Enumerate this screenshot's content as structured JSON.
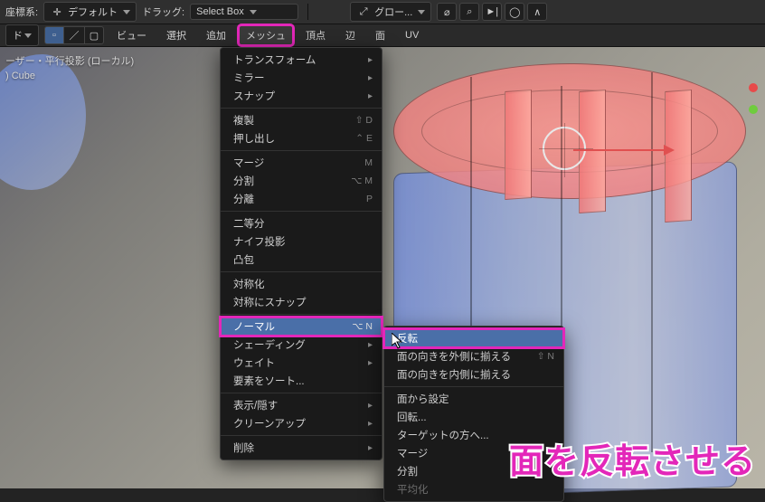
{
  "header": {
    "orient_label": "座標系:",
    "orient_value": "デフォルト",
    "drag_label": "ドラッグ:",
    "drag_value": "Select Box",
    "measure_value": "グロー..."
  },
  "toolbar": {
    "mode": "ド",
    "view": "ビュー",
    "select": "選択",
    "add": "追加",
    "mesh": "メッシュ",
    "vertex": "頂点",
    "edge": "辺",
    "face": "面",
    "uv": "UV"
  },
  "overlay": {
    "line1": "ーザー・平行投影 (ローカル)",
    "line2": ") Cube"
  },
  "menu": {
    "transform": "トランスフォーム",
    "mirror": "ミラー",
    "snap": "スナップ",
    "duplicate": "複製",
    "duplicate_hk": "⇧ D",
    "extrude": "押し出し",
    "extrude_hk": "⌃ E",
    "merge": "マージ",
    "merge_hk": "M",
    "split": "分割",
    "split_hk": "⌥ M",
    "separate": "分離",
    "separate_hk": "P",
    "bisect": "二等分",
    "knife": "ナイフ投影",
    "convex": "凸包",
    "symmetrize": "対称化",
    "snap_sym": "対称にスナップ",
    "normals": "ノーマル",
    "normals_hk": "⌥ N",
    "shading": "シェーディング",
    "weights": "ウェイト",
    "sort": "要素をソート...",
    "showhide": "表示/隠す",
    "cleanup": "クリーンアップ",
    "delete": "削除"
  },
  "submenu": {
    "flip": "反転",
    "recalc_out": "面の向きを外側に揃える",
    "recalc_out_hk": "⇧ N",
    "recalc_in": "面の向きを内側に揃える",
    "from_face": "面から設定",
    "rotate": "回転...",
    "point_target": "ターゲットの方へ...",
    "merge": "マージ",
    "split_n": "分割",
    "average": "平均化"
  },
  "annotation": "面を反転させる"
}
